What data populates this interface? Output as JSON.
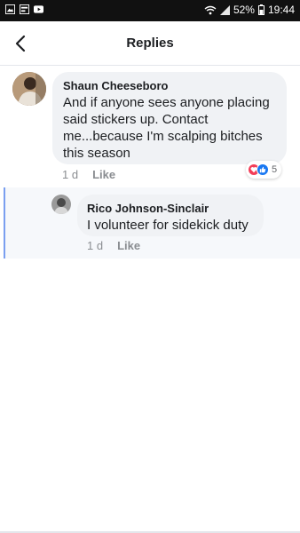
{
  "status_bar": {
    "battery_percent": "52%",
    "time": "19:44",
    "left_icons": [
      "gallery-icon",
      "media-icon",
      "youtube-icon"
    ]
  },
  "header": {
    "title": "Replies"
  },
  "comment": {
    "author": "Shaun Cheeseboro",
    "text": "And if anyone sees anyone placing said stickers up. Contact me...because I'm scalping bitches this season",
    "time": "1 d",
    "like_label": "Like",
    "reaction_count": "5",
    "reactions": [
      "love",
      "like"
    ]
  },
  "reply": {
    "author": "Rico Johnson-Sinclair",
    "text": "I volunteer for sidekick duty",
    "time": "1 d",
    "like_label": "Like"
  },
  "colors": {
    "accent": "#1877f2",
    "love": "#f33e58",
    "bubble": "#f0f2f5",
    "thread_line": "#7a9ff0"
  }
}
